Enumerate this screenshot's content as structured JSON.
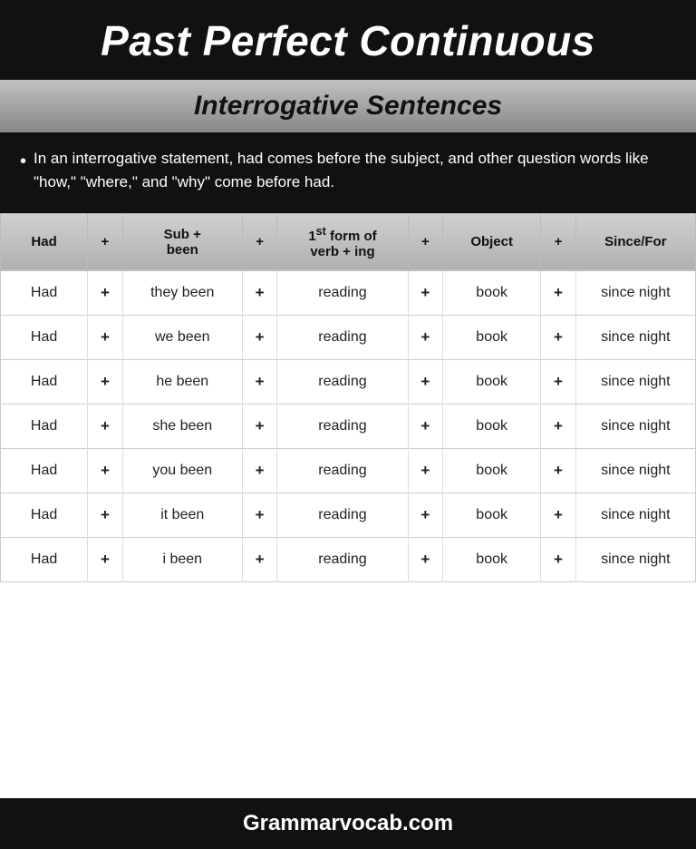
{
  "header": {
    "title": "Past Perfect Continuous"
  },
  "subtitle": {
    "text": "Interrogative Sentences"
  },
  "description": {
    "bullet": "In an interrogative statement, had comes before the subject, and other question words like \"how,\" \"where,\" and \"why\" come before had."
  },
  "table": {
    "columns": [
      {
        "label": "Had",
        "key": "had"
      },
      {
        "label": "+",
        "key": "plus1"
      },
      {
        "label": "Sub + been",
        "key": "sub"
      },
      {
        "label": "+",
        "key": "plus2"
      },
      {
        "label": "1st form of verb + ing",
        "key": "verb"
      },
      {
        "label": "+",
        "key": "plus3"
      },
      {
        "label": "Object",
        "key": "object"
      },
      {
        "label": "+",
        "key": "plus4"
      },
      {
        "label": "Since/For",
        "key": "sincefor"
      }
    ],
    "rows": [
      {
        "had": "Had",
        "plus1": "+",
        "sub": "they been",
        "plus2": "+",
        "verb": "reading",
        "plus3": "+",
        "object": "book",
        "plus4": "+",
        "sincefor": "since night"
      },
      {
        "had": "Had",
        "plus1": "+",
        "sub": "we been",
        "plus2": "+",
        "verb": "reading",
        "plus3": "+",
        "object": "book",
        "plus4": "+",
        "sincefor": "since night"
      },
      {
        "had": "Had",
        "plus1": "+",
        "sub": "he been",
        "plus2": "+",
        "verb": "reading",
        "plus3": "+",
        "object": "book",
        "plus4": "+",
        "sincefor": "since night"
      },
      {
        "had": "Had",
        "plus1": "+",
        "sub": "she been",
        "plus2": "+",
        "verb": "reading",
        "plus3": "+",
        "object": "book",
        "plus4": "+",
        "sincefor": "since night"
      },
      {
        "had": "Had",
        "plus1": "+",
        "sub": "you been",
        "plus2": "+",
        "verb": "reading",
        "plus3": "+",
        "object": "book",
        "plus4": "+",
        "sincefor": "since night"
      },
      {
        "had": "Had",
        "plus1": "+",
        "sub": "it been",
        "plus2": "+",
        "verb": "reading",
        "plus3": "+",
        "object": "book",
        "plus4": "+",
        "sincefor": "since night"
      },
      {
        "had": "Had",
        "plus1": "+",
        "sub": "i been",
        "plus2": "+",
        "verb": "reading",
        "plus3": "+",
        "object": "book",
        "plus4": "+",
        "sincefor": "since night"
      }
    ]
  },
  "footer": {
    "text": "Grammarvocab.com"
  }
}
